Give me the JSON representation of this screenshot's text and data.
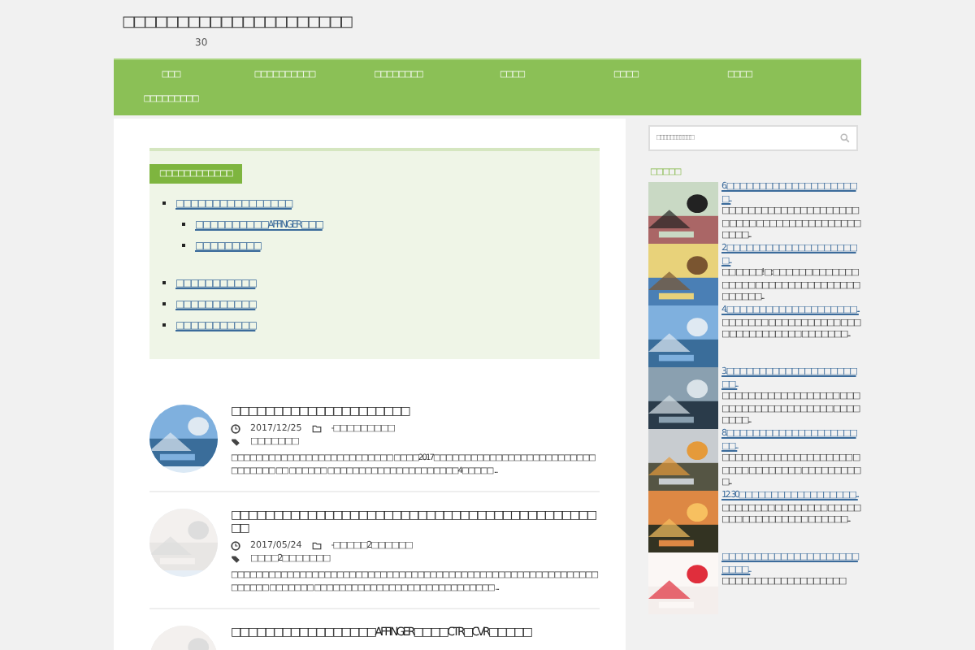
{
  "site": {
    "title": "□□□□□□□□□□□□□□□□□□□□□",
    "subtitle": "30"
  },
  "nav": {
    "items": [
      "□□□",
      "□□□□□□□□□□",
      "□□□□□□□□",
      "□□□□",
      "□□□□",
      "□□□□",
      "□□□□□□□□□"
    ]
  },
  "toc": {
    "heading": "□□□□□□□□□□□□",
    "items": [
      {
        "label": "□□□□□□□□□□□□□□□□",
        "children": [
          {
            "label": "□□□□□□□□□□AFFINGER□□□"
          },
          {
            "label": "□□□□□□□□□"
          }
        ]
      },
      {
        "label": "□□□□□□□□□□□"
      },
      {
        "label": "□□□□□□□□□□□"
      },
      {
        "label": "□□□□□□□□□□□"
      }
    ]
  },
  "posts": [
    {
      "title": "□□□□□□□□□□□□□□□□□□□□□",
      "date": "2017/12/25",
      "category": "-□□□□□□□□□",
      "tag": "□□□□□□□",
      "excerpt": "□□□□□□□□□□□□□□□□□□□□□□□□□□ □□□□2017□□□□□□□□□□□□□□□□□□□□□□□□□□□□□□□□□ □□ □□□□□□ □□□□□□□□□□□□□□□□□□□□□4□□□□□ ..."
    },
    {
      "title": "□□□□□□□□□□□□□□□□□□□□□□□□□□□□□□□□□□□□□□□□□□□□□",
      "date": "2017/05/24",
      "category": "-□□□□□2□□□□□□",
      "tag": "□□□□2□□□□□□□",
      "excerpt": "□□□□□□□□□□□□□□□□□□□□□□□□□□□□□□□□□□□□□□□□□□□□□□□□□□□□□□□□□□□□□□□□□ □□□□□□□ □□□□□□□□□□□□□□□□□□□□□□□□□□□□□ ..."
    },
    {
      "title": "□□□□□□□□□□□□□□□□□AFFINGER□□□□CTR□CVR□□□□□"
    }
  ],
  "sidebar": {
    "search": {
      "placeholder": "□□□□□□□□□□□"
    },
    "heading": "□□□□□",
    "ranking": [
      {
        "link": "6.□□□□□□□□□□□□□□□□□□□□□...",
        "text": "□□□□□□□□□□□□□□□□□□□□□□ □□□□ □□□□□□□□□□□□□□□□ □□□□..."
      },
      {
        "link": "2.□□□□□□□□□□□□□□□□□□□□□...",
        "text": "□□ □□□□! □: □□□□□□ □□□□□□□□□□□□ □□□□□□□□□□□□□□□□□□□□□□..."
      },
      {
        "link": "4.□□□□□□□□□□□□□□□□□□□□...",
        "text": "□□□□□□□ □□□□□□□□□□□ □□□□ □□□□□□□□□□□ □□□□□□□..."
      },
      {
        "link": "3.□□□□□□□□□□□□□□□□□□□□□□...",
        "text": "□□□□□□□□□□□□□□□□□□ □□□□□□□□□□□□□□□□□□□□ □□□□□□□□..."
      },
      {
        "link": "8.□□□□□□□□□□□□□□□□□□□□□□...",
        "text": "□□□□□□□□□□□□□□□□□□□□ □□□□□ □□□□□□□□ □□□□□□□□□□..."
      },
      {
        "link": "12. 30□□□□□□□□□□□□□□□□□□...",
        "text": "□□□□□□□□ □□□□□□□□ □□□□□□□□ □□□□□□□□□□ □□□□□□..."
      },
      {
        "link": "□□□□□□□□□□□□□□□□□□□□□□□□□...",
        "text": "□□□□□□□□□□□□□□□□□□□"
      }
    ]
  }
}
